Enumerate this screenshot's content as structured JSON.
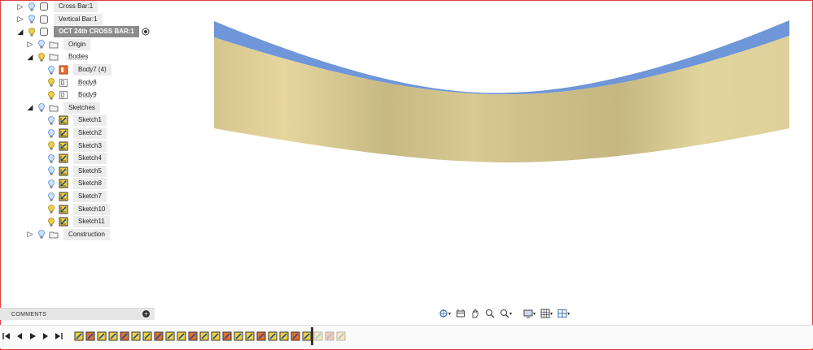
{
  "browser": {
    "items": [
      {
        "label": "Cross Bar:1",
        "icon": "component-icon",
        "expander": "collapsed",
        "bulb": "blue",
        "indent": 0,
        "row": 0
      },
      {
        "label": "Vertical Bar:1",
        "icon": "component-icon",
        "expander": "collapsed",
        "bulb": "blue",
        "indent": 0,
        "row": 1
      },
      {
        "label": "OCT 24th CROSS BAR:1",
        "icon": "component-icon",
        "expander": "expanded",
        "bulb": "yellow",
        "indent": 0,
        "row": 2,
        "selected": true
      },
      {
        "label": "Origin",
        "icon": "folder-icon",
        "expander": "collapsed",
        "bulb": "blue",
        "indent": 1,
        "row": 3
      },
      {
        "label": "Bodies",
        "icon": "folder-icon",
        "expander": "expanded",
        "bulb": "yellow",
        "indent": 1,
        "row": 4,
        "plain": true
      },
      {
        "label": "Body7 (4)",
        "icon": "body-icon",
        "expander": "none",
        "bulb": "blue",
        "indent": 2,
        "row": 5
      },
      {
        "label": "Body8",
        "icon": "body-hidden-icon",
        "expander": "none",
        "bulb": "yellow",
        "indent": 2,
        "row": 6,
        "plain": true
      },
      {
        "label": "Body9",
        "icon": "body-hidden-icon",
        "expander": "none",
        "bulb": "yellow",
        "indent": 2,
        "row": 7,
        "plain": true
      },
      {
        "label": "Sketches",
        "icon": "folder-icon",
        "expander": "expanded",
        "bulb": "blue",
        "indent": 1,
        "row": 8
      },
      {
        "label": "Sketch1",
        "icon": "sketch-icon",
        "expander": "none",
        "bulb": "blue",
        "indent": 2,
        "row": 9
      },
      {
        "label": "Sketch2",
        "icon": "sketch-icon",
        "expander": "none",
        "bulb": "blue",
        "indent": 2,
        "row": 10
      },
      {
        "label": "Sketch3",
        "icon": "sketch-icon",
        "expander": "none",
        "bulb": "yellow",
        "indent": 2,
        "row": 11
      },
      {
        "label": "Sketch4",
        "icon": "sketch-icon",
        "expander": "none",
        "bulb": "blue",
        "indent": 2,
        "row": 12
      },
      {
        "label": "Sketch5",
        "icon": "sketch-icon",
        "expander": "none",
        "bulb": "blue",
        "indent": 2,
        "row": 13
      },
      {
        "label": "Sketch8",
        "icon": "sketch-icon",
        "expander": "none",
        "bulb": "blue",
        "indent": 2,
        "row": 14
      },
      {
        "label": "Sketch7",
        "icon": "sketch-icon",
        "expander": "none",
        "bulb": "blue",
        "indent": 2,
        "row": 15
      },
      {
        "label": "Sketch10",
        "icon": "sketch-icon",
        "expander": "none",
        "bulb": "yellow",
        "indent": 2,
        "row": 16
      },
      {
        "label": "Sketch11",
        "icon": "sketch-icon",
        "expander": "none",
        "bulb": "yellow",
        "indent": 2,
        "row": 17
      },
      {
        "label": "Construction",
        "icon": "folder-icon",
        "expander": "collapsed",
        "bulb": "blue",
        "indent": 1,
        "row": 18
      }
    ]
  },
  "comments": {
    "label": "COMMENTS"
  },
  "colors": {
    "frame": "#e04040",
    "body_face": "#d8c88e",
    "body_top": "#6f96d8",
    "bulb_blue": "#5b8fd6",
    "bulb_yellow": "#f0d040"
  },
  "navbar": {
    "tools": [
      "orbit-icon",
      "look-at-icon",
      "pan-icon",
      "zoom-icon",
      "fit-icon",
      "display-settings-icon",
      "grid-icon",
      "viewports-icon"
    ]
  },
  "timeline": {
    "playback": [
      "go-to-start-icon",
      "previous-step-icon",
      "play-icon",
      "next-step-icon",
      "go-to-end-icon"
    ],
    "feature_count": 24
  }
}
